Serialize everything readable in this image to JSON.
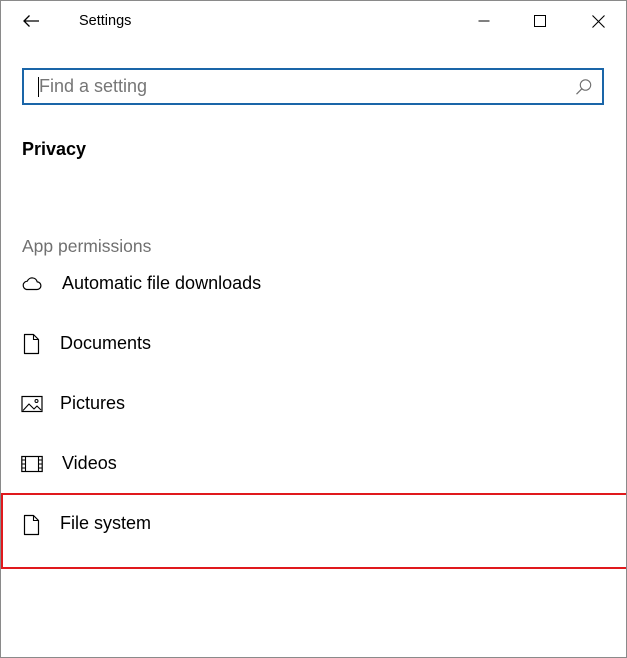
{
  "window": {
    "title": "Settings"
  },
  "controls": {
    "back_icon": "back-arrow-icon",
    "minimize_icon": "minimize-icon",
    "maximize_icon": "maximize-icon",
    "close_icon": "close-icon"
  },
  "search": {
    "placeholder": "Find a setting",
    "value": "",
    "icon": "search-icon",
    "border_color": "#1a65a8"
  },
  "page": {
    "title": "Privacy"
  },
  "section": {
    "header": "App permissions"
  },
  "nav_items": [
    {
      "label": "Automatic file downloads",
      "icon": "cloud-icon"
    },
    {
      "label": "Documents",
      "icon": "document-icon"
    },
    {
      "label": "Pictures",
      "icon": "picture-icon"
    },
    {
      "label": "Videos",
      "icon": "video-icon"
    },
    {
      "label": "File system",
      "icon": "file-icon",
      "highlighted": true
    }
  ],
  "colors": {
    "highlight_border": "#e0191d",
    "section_header_text": "#707070"
  }
}
